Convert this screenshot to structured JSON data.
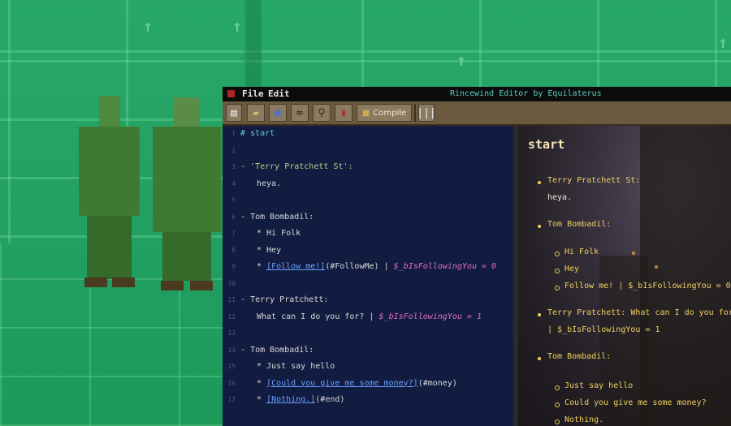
{
  "menubar": {
    "file": "File",
    "edit": "Edit",
    "title": "Rincewind Editor by Equilaterus"
  },
  "toolbar": {
    "compile_label": "Compile",
    "icons": [
      "new-file-icon",
      "open-folder-icon",
      "save-icon",
      "binoculars-icon",
      "magnifier-icon",
      "book-icon",
      "compile-icon",
      "columns-icon"
    ]
  },
  "code_lines": [
    {
      "n": "1"
    },
    {
      "n": "2"
    },
    {
      "n": "3"
    },
    {
      "n": "4"
    },
    {
      "n": "5"
    },
    {
      "n": "6"
    },
    {
      "n": "7"
    },
    {
      "n": "8"
    },
    {
      "n": "9"
    },
    {
      "n": "10"
    },
    {
      "n": "11"
    },
    {
      "n": "12"
    },
    {
      "n": "13"
    },
    {
      "n": "14"
    },
    {
      "n": "15"
    },
    {
      "n": "16"
    },
    {
      "n": "17"
    }
  ],
  "code": {
    "l1_hash": "#",
    "l1_name": "start",
    "l3_dash": "-",
    "l3_speaker": "'Terry Pratchett St':",
    "l4_text": "heya.",
    "l6_dash": "-",
    "l6_speaker": "Tom Bombadil:",
    "l7": "* Hi Folk",
    "l8": "* Hey",
    "l9_star": "*",
    "l9_link": "[Follow me!]",
    "l9_target": "(#FollowMe)",
    "l9_pipe": "|",
    "l9_var": "$_bIsFollowingYou = 0",
    "l11_dash": "-",
    "l11_speaker": "Terry Pratchett:",
    "l12_text": "What can I do you for? |",
    "l12_var": "$_bIsFollowingYou = 1",
    "l14_dash": "-",
    "l14_speaker": "Tom Bombadil:",
    "l15": "* Just say hello",
    "l16_star": "*",
    "l16_link": "[Could you give me some money?]",
    "l16_target": "(#money)",
    "l17_star": "*",
    "l17_link": "[Nothing.]",
    "l17_target": "(#end)"
  },
  "preview": {
    "heading": "start",
    "p1": "Terry Pratchett St:",
    "p1b": "heya.",
    "p2": "Tom Bombadil:",
    "p3": "Hi Folk",
    "p4": "Hey",
    "p5": "Follow me! | $_bIsFollowingYou = 0",
    "p6": "Terry Pratchett: What can I do you for?",
    "p6b": "| $_bIsFollowingYou = 1",
    "p7": "Tom Bombadil:",
    "p8": "Just say hello",
    "p9": "Could you give me some money?",
    "p10": "Nothing."
  },
  "colors": {
    "game_bg": "#1f9e5e",
    "code_bg": "#121b40",
    "toolbar": "#6b5a40",
    "preview_text": "#f0d060"
  }
}
